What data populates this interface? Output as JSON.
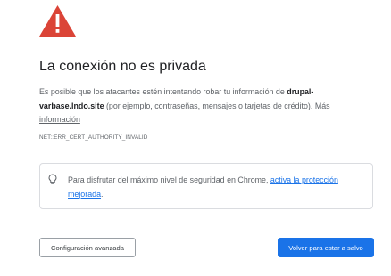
{
  "page": {
    "icon": "warning-triangle-icon",
    "title": "La conexión no es privada",
    "explanation": {
      "prefix": "Es posible que los atacantes estén intentando robar tu información de ",
      "domain": "drupal-varbase.lndo.site",
      "suffix": " (por ejemplo, contraseñas, mensajes o tarjetas de crédito). ",
      "learn_more_link": "Más información"
    },
    "error_code": "NET::ERR_CERT_AUTHORITY_INVALID",
    "protection": {
      "icon": "lightbulb-icon",
      "text": "Para disfrutar del máximo nivel de seguridad en Chrome, ",
      "link": "activa la protección mejorada",
      "suffix": "."
    },
    "buttons": {
      "advanced": "Configuración avanzada",
      "back_to_safety": "Volver para estar a salvo"
    }
  },
  "colors": {
    "warning_red": "#db4437",
    "link_blue": "#1a73e8",
    "text_secondary": "#5f6368",
    "text_primary": "#202124",
    "border": "#dadce0"
  }
}
